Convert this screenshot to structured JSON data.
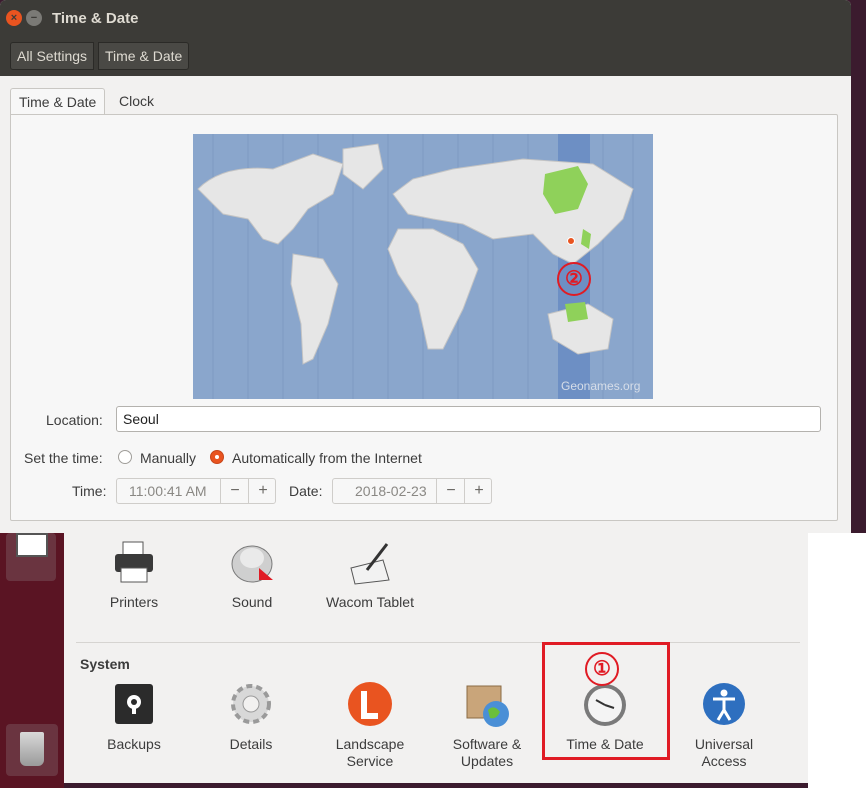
{
  "window": {
    "title": "Time & Date",
    "close_glyph": "×",
    "minimize_glyph": "−"
  },
  "breadcrumb": [
    "All Settings",
    "Time & Date"
  ],
  "tabs": [
    "Time & Date",
    "Clock"
  ],
  "map": {
    "credit": "Geonames.org",
    "marker": "②"
  },
  "location": {
    "label": "Location:",
    "value": "Seoul"
  },
  "set_time": {
    "label": "Set the time:",
    "options": [
      "Manually",
      "Automatically from the Internet"
    ],
    "selected": "Automatically from the Internet"
  },
  "time": {
    "label": "Time:",
    "value": "11:00:41 AM"
  },
  "date": {
    "label": "Date:",
    "value": "2018-02-23"
  },
  "spin_minus": "−",
  "spin_plus": "+",
  "system_settings": {
    "hardware_items": [
      "Printers",
      "Sound",
      "Wacom Tablet"
    ],
    "section": "System",
    "system_items": [
      "Backups",
      "Details",
      "Landscape\nService",
      "Software &\nUpdates",
      "Time & Date",
      "Universal\nAccess"
    ],
    "marker": "①"
  },
  "colors": {
    "accent": "#e95420",
    "highlight": "#e01b24",
    "selected_zone": "#8fd15a"
  }
}
